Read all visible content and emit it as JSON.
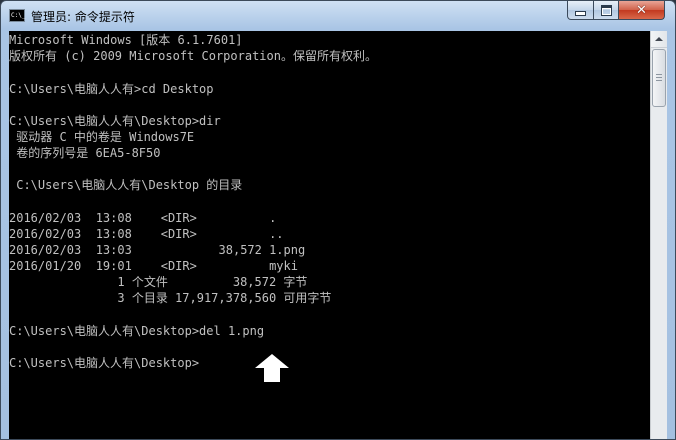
{
  "window": {
    "title": "管理员: 命令提示符",
    "app_icon_label": "C:\\_"
  },
  "controls": {
    "minimize_icon": "minimize-icon",
    "maximize_icon": "maximize-icon",
    "close_icon": "close-icon",
    "close_glyph": "✕"
  },
  "console": {
    "lines": [
      "Microsoft Windows [版本 6.1.7601]",
      "版权所有 (c) 2009 Microsoft Corporation。保留所有权利。",
      "",
      "C:\\Users\\电脑人人有>cd Desktop",
      "",
      "C:\\Users\\电脑人人有\\Desktop>dir",
      " 驱动器 C 中的卷是 Windows7E",
      " 卷的序列号是 6EA5-8F50",
      "",
      " C:\\Users\\电脑人人有\\Desktop 的目录",
      "",
      "2016/02/03  13:08    <DIR>          .",
      "2016/02/03  13:08    <DIR>          ..",
      "2016/02/03  13:03            38,572 1.png",
      "2016/01/20  19:01    <DIR>          myki",
      "               1 个文件         38,572 字节",
      "               3 个目录 17,917,378,560 可用字节",
      "",
      "C:\\Users\\电脑人人有\\Desktop>del 1.png",
      "",
      "C:\\Users\\电脑人人有\\Desktop>"
    ],
    "colors": {
      "background": "#000000",
      "text": "#c0c0c0"
    }
  },
  "overlay": {
    "arrow_icon": "up-arrow-icon",
    "arrow_color": "#ffffff"
  }
}
